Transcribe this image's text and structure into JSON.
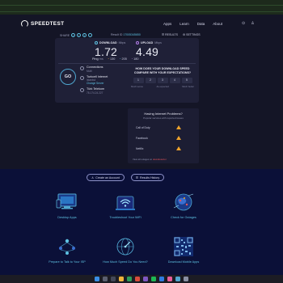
{
  "header": {
    "logo_text": "SPEEDTEST",
    "nav": [
      "Apps",
      "Learn",
      "Data",
      "About"
    ],
    "icons": [
      "help-icon",
      "user-icon"
    ]
  },
  "share": {
    "label": "SHARE",
    "result_label": "Result ID",
    "result_id": "17005345650",
    "links": [
      "RESULTS",
      "SETTINGS"
    ]
  },
  "results": {
    "download": {
      "label": "DOWNLOAD",
      "unit": "Mbps",
      "value": "1.72",
      "color": "#5fc3e4"
    },
    "upload": {
      "label": "UPLOAD",
      "unit": "Mbps",
      "value": "4.49",
      "color": "#b37ee8"
    },
    "ping": {
      "label": "Ping",
      "unit": "ms",
      "idle": "130",
      "download": "205",
      "upload": "180"
    }
  },
  "go_label": "GO",
  "connections": {
    "title": "Connections",
    "mode": "Multi",
    "isp": "Turkcell Internet",
    "isp_location": "Istanbul",
    "change_server": "Change Server",
    "host": "Türk Telekom",
    "host_ip": "78.174.24.227"
  },
  "rating": {
    "question": "HOW DOES YOUR DOWNLOAD SPEED COMPARE WITH YOUR EXPECTATIONS?",
    "options": [
      "1",
      "2",
      "3",
      "4",
      "5"
    ],
    "low_label": "Much worse",
    "mid_label": "As expected",
    "high_label": "Much better"
  },
  "problems": {
    "title": "Having Internet Problems?",
    "subtitle": "Popular services with reported issues",
    "items": [
      "Call of Duty",
      "Facebook",
      "Netflix"
    ],
    "footer_prefix": "View all outages on",
    "footer_link": "downdetector"
  },
  "buttons": {
    "create_account": "Create an Account",
    "results_history": "Results History"
  },
  "tiles": [
    {
      "caption": "Desktop Apps",
      "icon": "desktop-icon"
    },
    {
      "caption": "Troubleshoot Your WiFi",
      "icon": "wifi-icon"
    },
    {
      "caption": "Check for Outages",
      "icon": "globe-outage-icon"
    },
    {
      "caption": "Prepare to Talk to Your ISP",
      "icon": "people-network-icon"
    },
    {
      "caption": "How Much Speed Do You Need?",
      "icon": "speed-globe-icon"
    },
    {
      "caption": "Download Mobile Apps",
      "icon": "qr-code-icon"
    }
  ]
}
